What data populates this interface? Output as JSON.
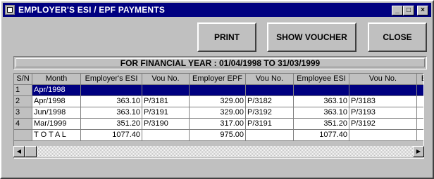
{
  "window": {
    "title": "EMPLOYER'S ESI / EPF PAYMENTS",
    "controls": {
      "minimize": "_",
      "maximize": "□",
      "close": "×"
    }
  },
  "toolbar": {
    "print_label": "PRINT",
    "voucher_label": "SHOW VOUCHER",
    "close_label": "CLOSE"
  },
  "financial_year": "FOR FINANCIAL YEAR : 01/04/1998 TO 31/03/1999",
  "grid": {
    "columns": [
      "S/N",
      "Month",
      "Employer's ESI",
      "Vou No.",
      "Employer EPF",
      "Vou No.",
      "Employee ESI",
      "Vou No.",
      "E"
    ],
    "rows": [
      [
        "1",
        "Apr/1998",
        "",
        "",
        "",
        "",
        "",
        "",
        ""
      ],
      [
        "2",
        "Apr/1998",
        "363.10",
        "P/3181",
        "329.00",
        "P/3182",
        "363.10",
        "P/3183",
        ""
      ],
      [
        "3",
        "Jun/1998",
        "363.10",
        "P/3191",
        "329.00",
        "P/3192",
        "363.10",
        "P/3193",
        ""
      ],
      [
        "4",
        "Mar/1999",
        "351.20",
        "P/3190",
        "317.00",
        "P/3191",
        "351.20",
        "P/3192",
        ""
      ]
    ],
    "total": [
      "",
      "T O T A L",
      "1077.40",
      "",
      "975.00",
      "",
      "1077.40",
      "",
      ""
    ],
    "selected_row": 0
  },
  "scrollbar": {
    "left_arrow": "◀",
    "right_arrow": "▶"
  }
}
